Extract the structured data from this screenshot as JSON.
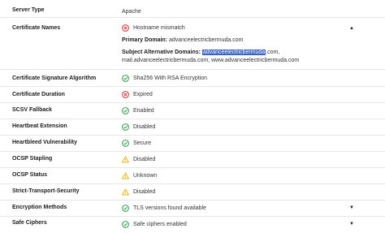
{
  "rows": [
    {
      "label": "Server Type",
      "value": "Apache",
      "status": "none"
    },
    {
      "label": "Certificate Names",
      "value": "Hostname mismatch",
      "status": "error",
      "caret": "▲"
    },
    {
      "label": "Certificate Signature Algorithm",
      "value": "Sha256 With RSA Encryption",
      "status": "ok"
    },
    {
      "label": "Certificate Duration",
      "value": "Expired",
      "status": "error"
    },
    {
      "label": "SCSV Fallback",
      "value": "Enabled",
      "status": "ok"
    },
    {
      "label": "Heartbeat Extension",
      "value": "Disabled",
      "status": "ok"
    },
    {
      "label": "Heartbleed Vulnerability",
      "value": "Secure",
      "status": "ok"
    },
    {
      "label": "OCSP Stapling",
      "value": "Disabled",
      "status": "warn"
    },
    {
      "label": "OCSP Status",
      "value": "Unknown",
      "status": "warn"
    },
    {
      "label": "Strict-Transport-Security",
      "value": "Disabled",
      "status": "warn"
    },
    {
      "label": "Encryption Methods",
      "value": "TLS versions found available",
      "status": "ok",
      "caret": "▼"
    },
    {
      "label": "Safe Ciphers",
      "value": "Safe ciphers enabled",
      "status": "ok",
      "caret": "▼"
    }
  ],
  "cert_details": {
    "primary_label": "Primary Domain:",
    "primary_value": "advanceelectricbermuda.com",
    "san_label": "Subject Alternative Domains:",
    "san_selected": "advanceelectricbermuda",
    "san_rest": ".com,",
    "san_line2": "mail.advanceelectricbermuda.com, www.advanceelectricbermuda.com"
  },
  "colors": {
    "ok": "#2e9e44",
    "error": "#d12d2d",
    "warn": "#f2b400"
  }
}
